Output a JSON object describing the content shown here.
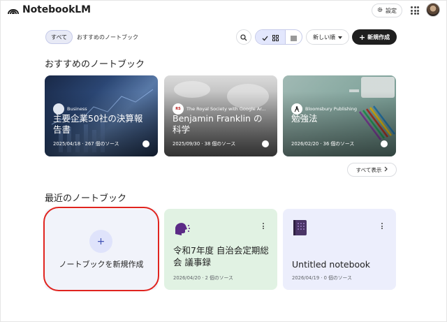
{
  "app": {
    "title": "NotebookLM",
    "settings_label": "設定"
  },
  "filters": {
    "all": "すべて",
    "recommended": "おすすめのノートブック",
    "sort_label": "新しい順",
    "new_label": "新規作成"
  },
  "recommended": {
    "heading": "おすすめのノートブック",
    "show_all": "すべて表示",
    "cards": [
      {
        "source": "Business",
        "title": "主要企業50社の決算報告書",
        "meta": "2025/04/18 · 267 個のソース"
      },
      {
        "source": "The Royal Society with Google Ar...",
        "title": "Benjamin Franklin の科学",
        "meta": "2025/09/30 · 38 個のソース"
      },
      {
        "source": "Bloomsbury Publishing",
        "title": "勉強法",
        "meta": "2026/02/20 · 36 個のソース"
      }
    ]
  },
  "recent": {
    "heading": "最近のノートブック",
    "create_label": "ノートブックを新規作成",
    "notebooks": [
      {
        "title": "令和7年度 自治会定期総会 議事録",
        "meta": "2026/04/20 · 2 個のソース"
      },
      {
        "title": "Untitled notebook",
        "meta": "2026/04/19 · 0 個のソース"
      }
    ]
  },
  "colors": {
    "accent": "#3f51b5",
    "highlight_ring": "#e0241f",
    "green_card": "#e1f2e3",
    "lilac_card": "#eceefc"
  }
}
